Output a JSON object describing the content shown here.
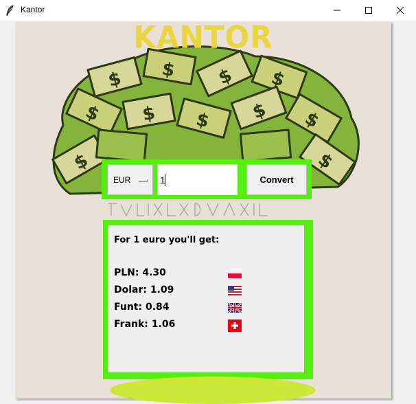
{
  "window": {
    "title": "Kantor"
  },
  "app": {
    "logo_text": "KANTOR",
    "currency_select": {
      "selected": "EUR"
    },
    "amount_input": {
      "value": "1"
    },
    "convert_button": {
      "label": "Convert"
    },
    "result": {
      "heading": "For 1 euro you'll get:",
      "rows": [
        {
          "label": "PLN: 4.30",
          "flag": "poland-flag-icon"
        },
        {
          "label": "Dolar: 1.09",
          "flag": "usa-flag-icon"
        },
        {
          "label": "Funt: 0.84",
          "flag": "uk-flag-icon"
        },
        {
          "label": "Frank: 1.06",
          "flag": "switzerland-flag-icon"
        }
      ]
    }
  },
  "colors": {
    "frame_green": "#55ee10",
    "logo_yellow": "#e9d441",
    "canvas_bg": "#e9e0d8",
    "money_green": "#7bab3b"
  }
}
